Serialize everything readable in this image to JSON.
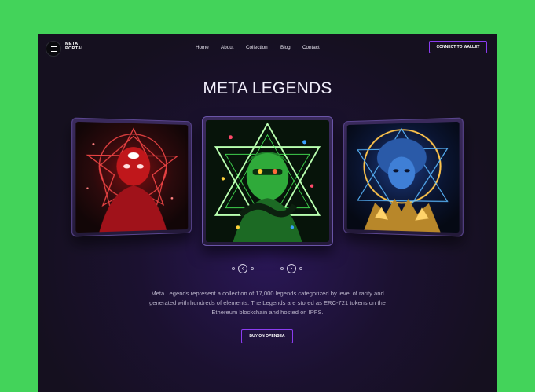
{
  "brand": {
    "line1": "META",
    "line2": "PORTAL"
  },
  "nav": {
    "items": [
      "Home",
      "About",
      "Collection",
      "Blog",
      "Contact"
    ]
  },
  "header": {
    "wallet_label": "CONNECT TO WALLET"
  },
  "hero": {
    "title": "META LEGENDS",
    "description": "Meta Legends represent a collection of 17,000 legends categorized by level of rarity and generated with hundreds of elements. The Legends are stored as ERC-721 tokens on the Ethereum blockchain and hosted on IPFS.",
    "cta_label": "BUY ON OPENSEA"
  },
  "carousel": {
    "prev_icon": "chevron-left-icon",
    "next_icon": "chevron-right-icon",
    "prev_glyph": "‹",
    "next_glyph": "›"
  },
  "colors": {
    "page_bg": "#43d35a",
    "frame_bg": "#1b1130",
    "accent": "#8b3cf0",
    "text": "#f1eefb",
    "muted_text": "#b9b3c9"
  }
}
